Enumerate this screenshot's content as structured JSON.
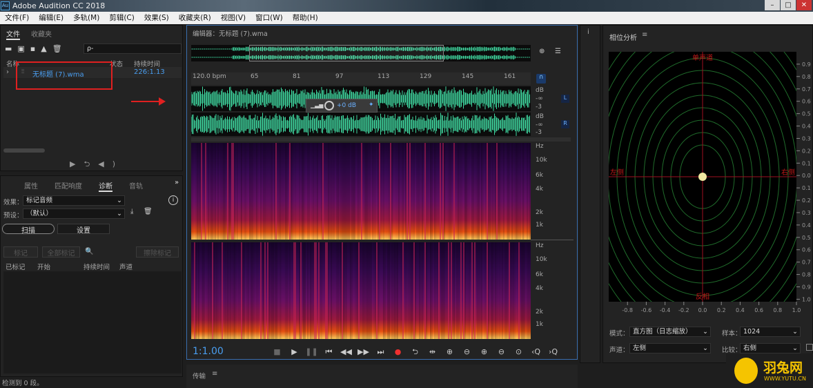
{
  "app": {
    "title": "Adobe Audition CC 2018",
    "logo": "Au",
    "window_buttons": [
      "–",
      "□",
      "✕"
    ]
  },
  "menu": [
    "文件(F)",
    "编辑(E)",
    "多轨(M)",
    "剪辑(C)",
    "效果(S)",
    "收藏夹(R)",
    "视图(V)",
    "窗口(W)",
    "帮助(H)"
  ],
  "files_panel": {
    "tabs": [
      "文件",
      "收藏夹"
    ],
    "columns": [
      "名称",
      "状态",
      "持续时间"
    ],
    "items": [
      {
        "name": "无标题 (7).wma",
        "duration": "226:1.13"
      }
    ],
    "search_placeholder": "ρ-"
  },
  "diag_panel": {
    "tabs": [
      "属性",
      "匹配响度",
      "诊断",
      "音轨"
    ],
    "effect_label": "效果：",
    "effect_value": "标记音频",
    "preset_label": "预设：",
    "preset_value": "（默认）",
    "scan": "扫描",
    "settings": "设置",
    "mark": "标记",
    "mark_all": "全部标记",
    "erase": "擦除标记",
    "columns": [
      "已标记",
      "开始",
      "持续时间",
      "声道"
    ]
  },
  "status": "检测到 0 段。",
  "editor": {
    "title": "编辑器：无标题 (7).wma",
    "ruler": [
      "120.0 bpm",
      "65",
      "81",
      "97",
      "113",
      "129",
      "145",
      "161"
    ],
    "db_labels": [
      "dB",
      "-∞",
      "-3"
    ],
    "channels": [
      "L",
      "R"
    ],
    "hud_value": "+0 dB",
    "freq_labels": [
      "Hz",
      "10k",
      "6k",
      "4k",
      "2k",
      "1k"
    ],
    "time": "1:1.00",
    "wave_color": "#3fd8a0"
  },
  "transport_panel": {
    "title": "传输"
  },
  "phase": {
    "title": "相位分析",
    "top": "单声道",
    "bottom": "反相",
    "left": "左侧",
    "right": "右侧",
    "y_ticks": [
      "0.9",
      "0.8",
      "0.7",
      "0.6",
      "0.5",
      "0.4",
      "0.3",
      "0.2",
      "0.1",
      "0.0",
      "0.1",
      "0.2",
      "0.3",
      "0.4",
      "0.5",
      "0.6",
      "0.7",
      "0.8",
      "0.9",
      "1.0"
    ],
    "x_ticks": [
      "-0.8",
      "-0.6",
      "-0.4",
      "-0.2",
      "0.0",
      "0.2",
      "0.4",
      "0.6",
      "0.8",
      "1.0"
    ],
    "mode_label": "模式：",
    "mode_value": "直方图（日志缩放）",
    "sample_label": "样本：",
    "sample_value": "1024",
    "channel_label": "声道：",
    "channel_value": "左侧",
    "compare_label": "比较：",
    "compare_value": "右侧"
  },
  "watermark": {
    "name": "羽兔网",
    "url": "WWW.YUTU.CN"
  }
}
